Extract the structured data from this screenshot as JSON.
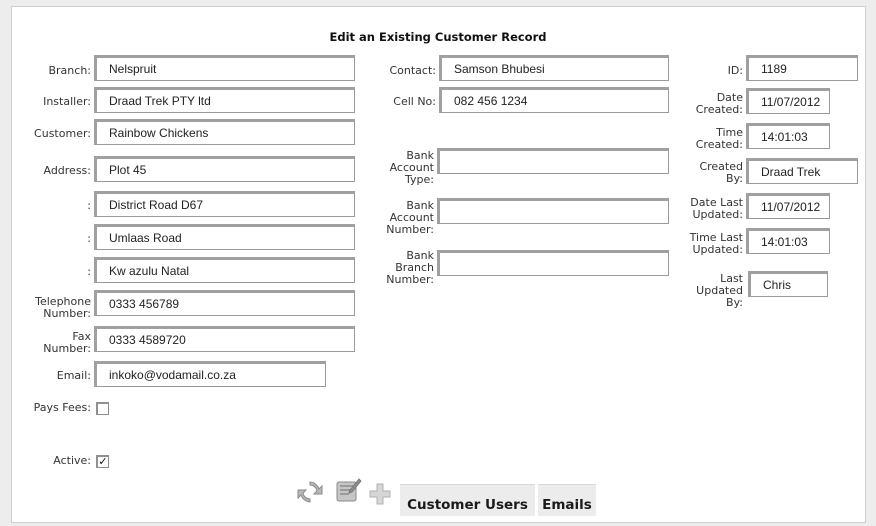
{
  "title": "Edit an Existing Customer Record",
  "left": {
    "branch": {
      "label": "Branch:",
      "value": "Nelspruit"
    },
    "installer": {
      "label": "Installer:",
      "value": "Draad Trek PTY ltd"
    },
    "customer": {
      "label": "Customer:",
      "value": "Rainbow Chickens"
    },
    "address": {
      "label": "Address:",
      "value": "Plot 45"
    },
    "address2": {
      "label": ":",
      "value": "District Road D67"
    },
    "address3": {
      "label": ":",
      "value": "Umlaas Road"
    },
    "address4": {
      "label": ":",
      "value": "Kw azulu Natal"
    },
    "telephone": {
      "label1": "Telephone",
      "label2": "Number:",
      "value": "0333 456789"
    },
    "fax": {
      "label1": "Fax",
      "label2": "Number:",
      "value": "0333 4589720"
    },
    "email": {
      "label": "Email:",
      "value": "inkoko@vodamail.co.za"
    },
    "pays_fees": {
      "label": "Pays Fees:",
      "checked": false
    },
    "active": {
      "label": "Active:",
      "checked": true,
      "mark": "✓"
    }
  },
  "middle": {
    "contact": {
      "label": "Contact:",
      "value": "Samson Bhubesi"
    },
    "cell": {
      "label": "Cell No:",
      "value": "082 456 1234"
    },
    "bank_type": {
      "label1": "Bank",
      "label2": "Account",
      "label3": "Type:",
      "value": ""
    },
    "bank_number": {
      "label1": "Bank",
      "label2": "Account",
      "label3": "Number:",
      "value": ""
    },
    "bank_branch": {
      "label1": "Bank",
      "label2": "Branch",
      "label3": "Number:",
      "value": ""
    }
  },
  "right": {
    "id": {
      "label": "ID:",
      "value": "1189"
    },
    "date_created": {
      "label1": "Date",
      "label2": "Created:",
      "value": "11/07/2012"
    },
    "time_created": {
      "label1": "Time",
      "label2": "Created:",
      "value": "14:01:03"
    },
    "created_by": {
      "label1": "Created",
      "label2": "By:",
      "value": "Draad Trek"
    },
    "date_updated": {
      "label1": "Date Last",
      "label2": "Updated:",
      "value": "11/07/2012"
    },
    "time_updated": {
      "label1": "Time Last",
      "label2": "Updated:",
      "value": "14:01:03"
    },
    "updated_by": {
      "label1": "Last",
      "label2": "Updated",
      "label3": "By:",
      "value": "Chris"
    }
  },
  "toolbar": {
    "icons": [
      "refresh-icon",
      "edit-icon",
      "add-icon"
    ],
    "customer_users_label": "Customer Users",
    "emails_label": "Emails"
  }
}
